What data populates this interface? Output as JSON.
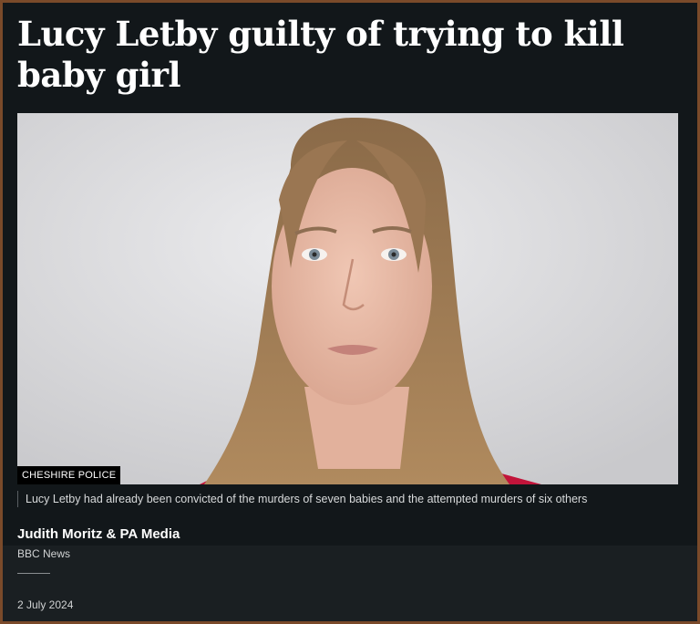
{
  "article": {
    "headline": "Lucy Letby guilty of trying to kill baby girl",
    "image_credit": "CHESHIRE POLICE",
    "image_caption": "Lucy Letby had already been convicted of the murders of seven babies and the attempted murders of six others",
    "byline": {
      "authors": "Judith Moritz & PA Media",
      "organisation": "BBC News"
    },
    "date": "2 July 2024"
  },
  "colors": {
    "page_background": "#12171a",
    "border": "#7a4a2a",
    "text": "#ffffff"
  }
}
